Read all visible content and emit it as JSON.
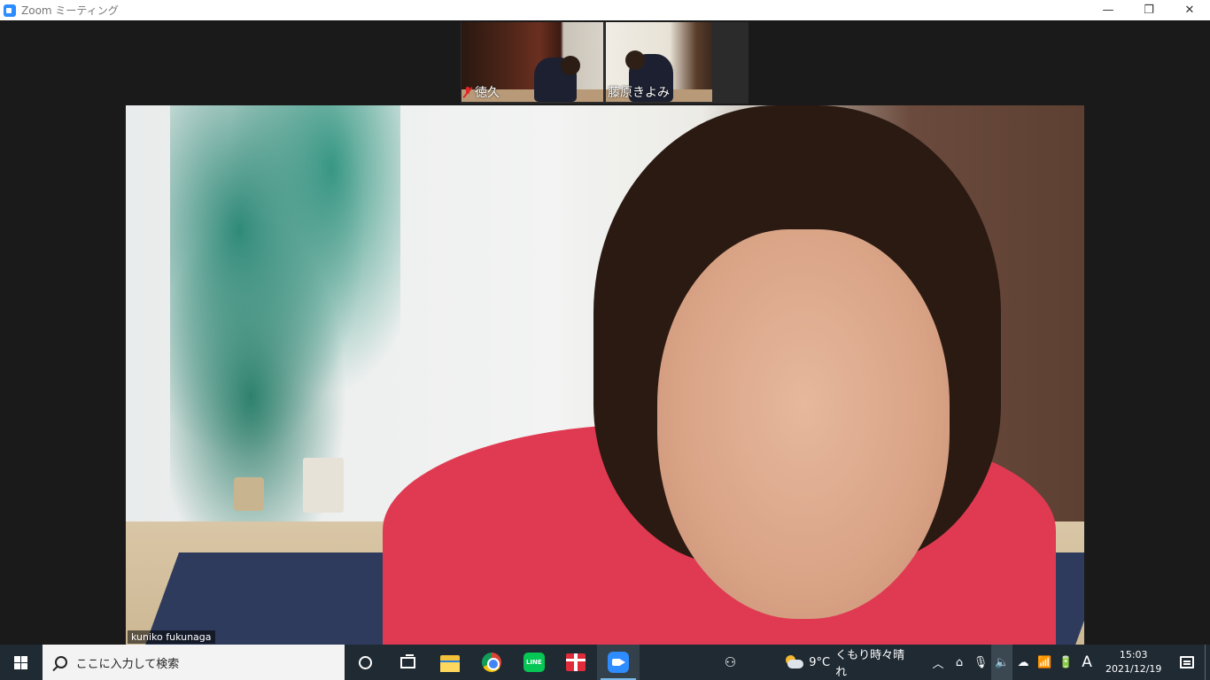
{
  "window": {
    "title": "Zoom ミーティング",
    "minimize_glyph": "—",
    "restore_glyph": "❐",
    "close_glyph": "✕"
  },
  "participants": {
    "thumbnails": [
      {
        "name": "徳久",
        "muted": true
      },
      {
        "name": "藤原きよみ",
        "muted": false
      }
    ],
    "speaker": {
      "name": "kuniko fukunaga"
    }
  },
  "taskbar": {
    "search_placeholder": "ここに入力して検索",
    "line_label": "LINE",
    "weather": {
      "temperature": "9°C",
      "condition": "くもり時々晴れ"
    },
    "ime": "A",
    "clock": {
      "time": "15:03",
      "date": "2021/12/19"
    },
    "tray_glyphs": {
      "chevron": "︿",
      "mic": "🎙",
      "volume": "🔈",
      "cloud": "☁",
      "wifi": "📶",
      "battery": "🔋",
      "meet": "⌂",
      "people": "⚇"
    }
  },
  "colors": {
    "accent_zoom": "#2d8cff",
    "taskbar_bg": "#1f2a33",
    "mute_red": "#e02828"
  },
  "icons": [
    "zoom-app-icon",
    "minimize-icon",
    "restore-icon",
    "close-icon",
    "mic-off-icon",
    "windows-logo-icon",
    "search-icon",
    "cortana-icon",
    "task-view-icon",
    "file-explorer-icon",
    "chrome-icon",
    "line-icon",
    "gift-icon",
    "zoom-taskbar-icon",
    "people-icon",
    "weather-icon",
    "notification-icon"
  ]
}
